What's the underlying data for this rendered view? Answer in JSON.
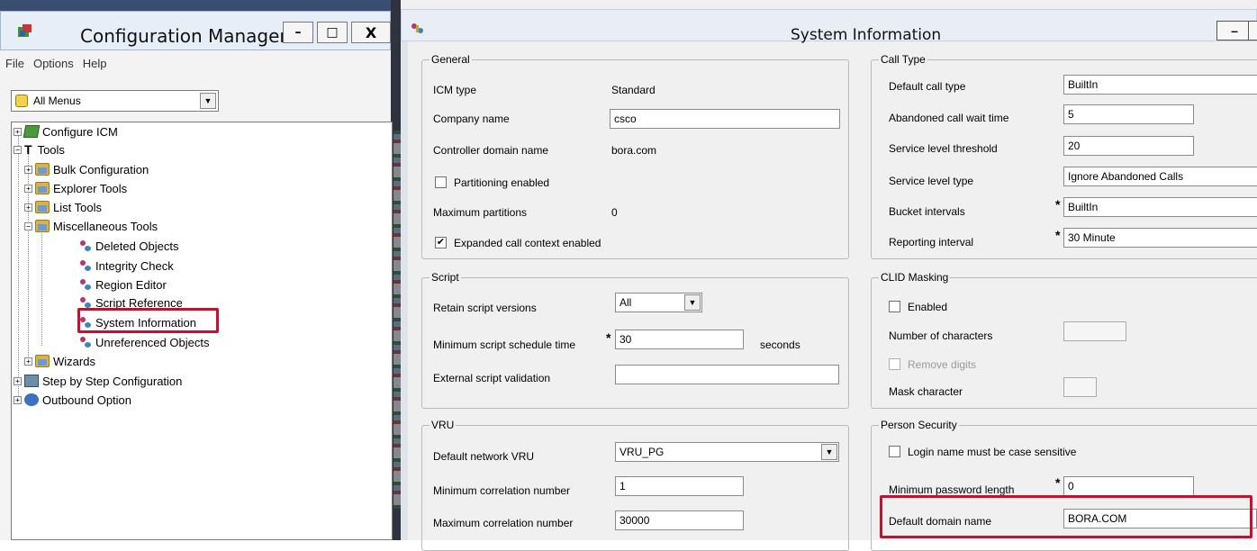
{
  "config_manager": {
    "title": "Configuration Manager",
    "controls": {
      "minimize": "–",
      "maximize": "□",
      "close": "X"
    },
    "menu": [
      "File",
      "Options",
      "Help"
    ],
    "menu_select": {
      "value": "All Menus"
    },
    "tree": [
      {
        "label": "Configure ICM",
        "expander": "+"
      },
      {
        "label": "Tools",
        "expander": "−"
      },
      {
        "label": "Bulk Configuration",
        "expander": "+"
      },
      {
        "label": "Explorer Tools",
        "expander": "+"
      },
      {
        "label": "List Tools",
        "expander": "+"
      },
      {
        "label": "Miscellaneous Tools",
        "expander": "−"
      },
      {
        "label": "Deleted Objects"
      },
      {
        "label": "Integrity Check"
      },
      {
        "label": "Region Editor"
      },
      {
        "label": "Script Reference"
      },
      {
        "label": "System Information",
        "highlighted": true
      },
      {
        "label": "Unreferenced Objects"
      },
      {
        "label": "Wizards",
        "expander": "+"
      },
      {
        "label": "Step by Step Configuration",
        "expander": "+"
      },
      {
        "label": "Outbound Option",
        "expander": "+"
      }
    ],
    "tools_glyph": "T"
  },
  "system_information": {
    "title": "System Information",
    "minimize": "–",
    "general": {
      "title": "General",
      "icm_type_label": "ICM type",
      "icm_type_value": "Standard",
      "company_name_label": "Company name",
      "company_name_value": "csco",
      "controller_domain_label": "Controller domain name",
      "controller_domain_value": "bora.com",
      "partitioning_label": "Partitioning enabled",
      "partitioning_checked": false,
      "max_partitions_label": "Maximum partitions",
      "max_partitions_value": "0",
      "expanded_context_label": "Expanded call context enabled",
      "expanded_context_checked": true
    },
    "script": {
      "title": "Script",
      "retain_label": "Retain script versions",
      "retain_value": "All",
      "min_schedule_label": "Minimum script schedule time",
      "min_schedule_value": "30",
      "min_schedule_unit": "seconds",
      "external_validation_label": "External script validation",
      "external_validation_value": ""
    },
    "vru": {
      "title": "VRU",
      "default_vru_label": "Default network VRU",
      "default_vru_value": "VRU_PG",
      "min_corr_label": "Minimum correlation number",
      "min_corr_value": "1",
      "max_corr_label": "Maximum correlation number",
      "max_corr_value": "30000"
    },
    "call_type": {
      "title": "Call Type",
      "default_call_type_label": "Default call type",
      "default_call_type_value": "BuiltIn",
      "abandoned_wait_label": "Abandoned call wait time",
      "abandoned_wait_value": "5",
      "service_level_threshold_label": "Service level threshold",
      "service_level_threshold_value": "20",
      "service_level_type_label": "Service level type",
      "service_level_type_value": "Ignore Abandoned Calls",
      "bucket_intervals_label": "Bucket intervals",
      "bucket_intervals_value": "BuiltIn",
      "reporting_interval_label": "Reporting interval",
      "reporting_interval_value": "30 Minute"
    },
    "clid_masking": {
      "title": "CLID Masking",
      "enabled_label": "Enabled",
      "enabled_checked": false,
      "num_chars_label": "Number of characters",
      "num_chars_value": "",
      "remove_digits_label": "Remove digits",
      "mask_char_label": "Mask character",
      "mask_char_value": ""
    },
    "person_security": {
      "title": "Person Security",
      "case_sensitive_label": "Login name must be case sensitive",
      "case_sensitive_checked": false,
      "min_password_label": "Minimum password length",
      "min_password_value": "0",
      "default_domain_label": "Default domain name",
      "default_domain_value": "BORA.COM"
    },
    "required_marker": "*"
  },
  "colors": {
    "highlight_red": "#c8102e",
    "window_bg": "#f0f0f0"
  }
}
